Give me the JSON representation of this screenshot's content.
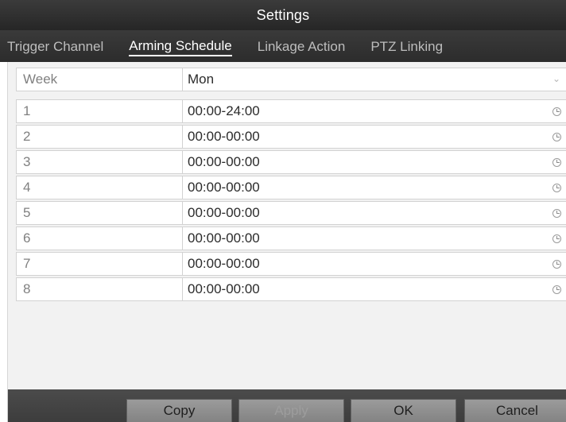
{
  "window": {
    "title": "Settings"
  },
  "tabs": [
    {
      "label": "Trigger Channel",
      "active": false
    },
    {
      "label": "Arming Schedule",
      "active": true
    },
    {
      "label": "Linkage Action",
      "active": false
    },
    {
      "label": "PTZ Linking",
      "active": false
    }
  ],
  "schedule": {
    "week_label": "Week",
    "week_value": "Mon",
    "rows": [
      {
        "index": "1",
        "time": "00:00-24:00"
      },
      {
        "index": "2",
        "time": "00:00-00:00"
      },
      {
        "index": "3",
        "time": "00:00-00:00"
      },
      {
        "index": "4",
        "time": "00:00-00:00"
      },
      {
        "index": "5",
        "time": "00:00-00:00"
      },
      {
        "index": "6",
        "time": "00:00-00:00"
      },
      {
        "index": "7",
        "time": "00:00-00:00"
      },
      {
        "index": "8",
        "time": "00:00-00:00"
      }
    ]
  },
  "buttons": {
    "copy": "Copy",
    "apply": "Apply",
    "ok": "OK",
    "cancel": "Cancel"
  },
  "icons": {
    "clock": "clock-icon",
    "dropdown": "chevron-down-icon"
  }
}
